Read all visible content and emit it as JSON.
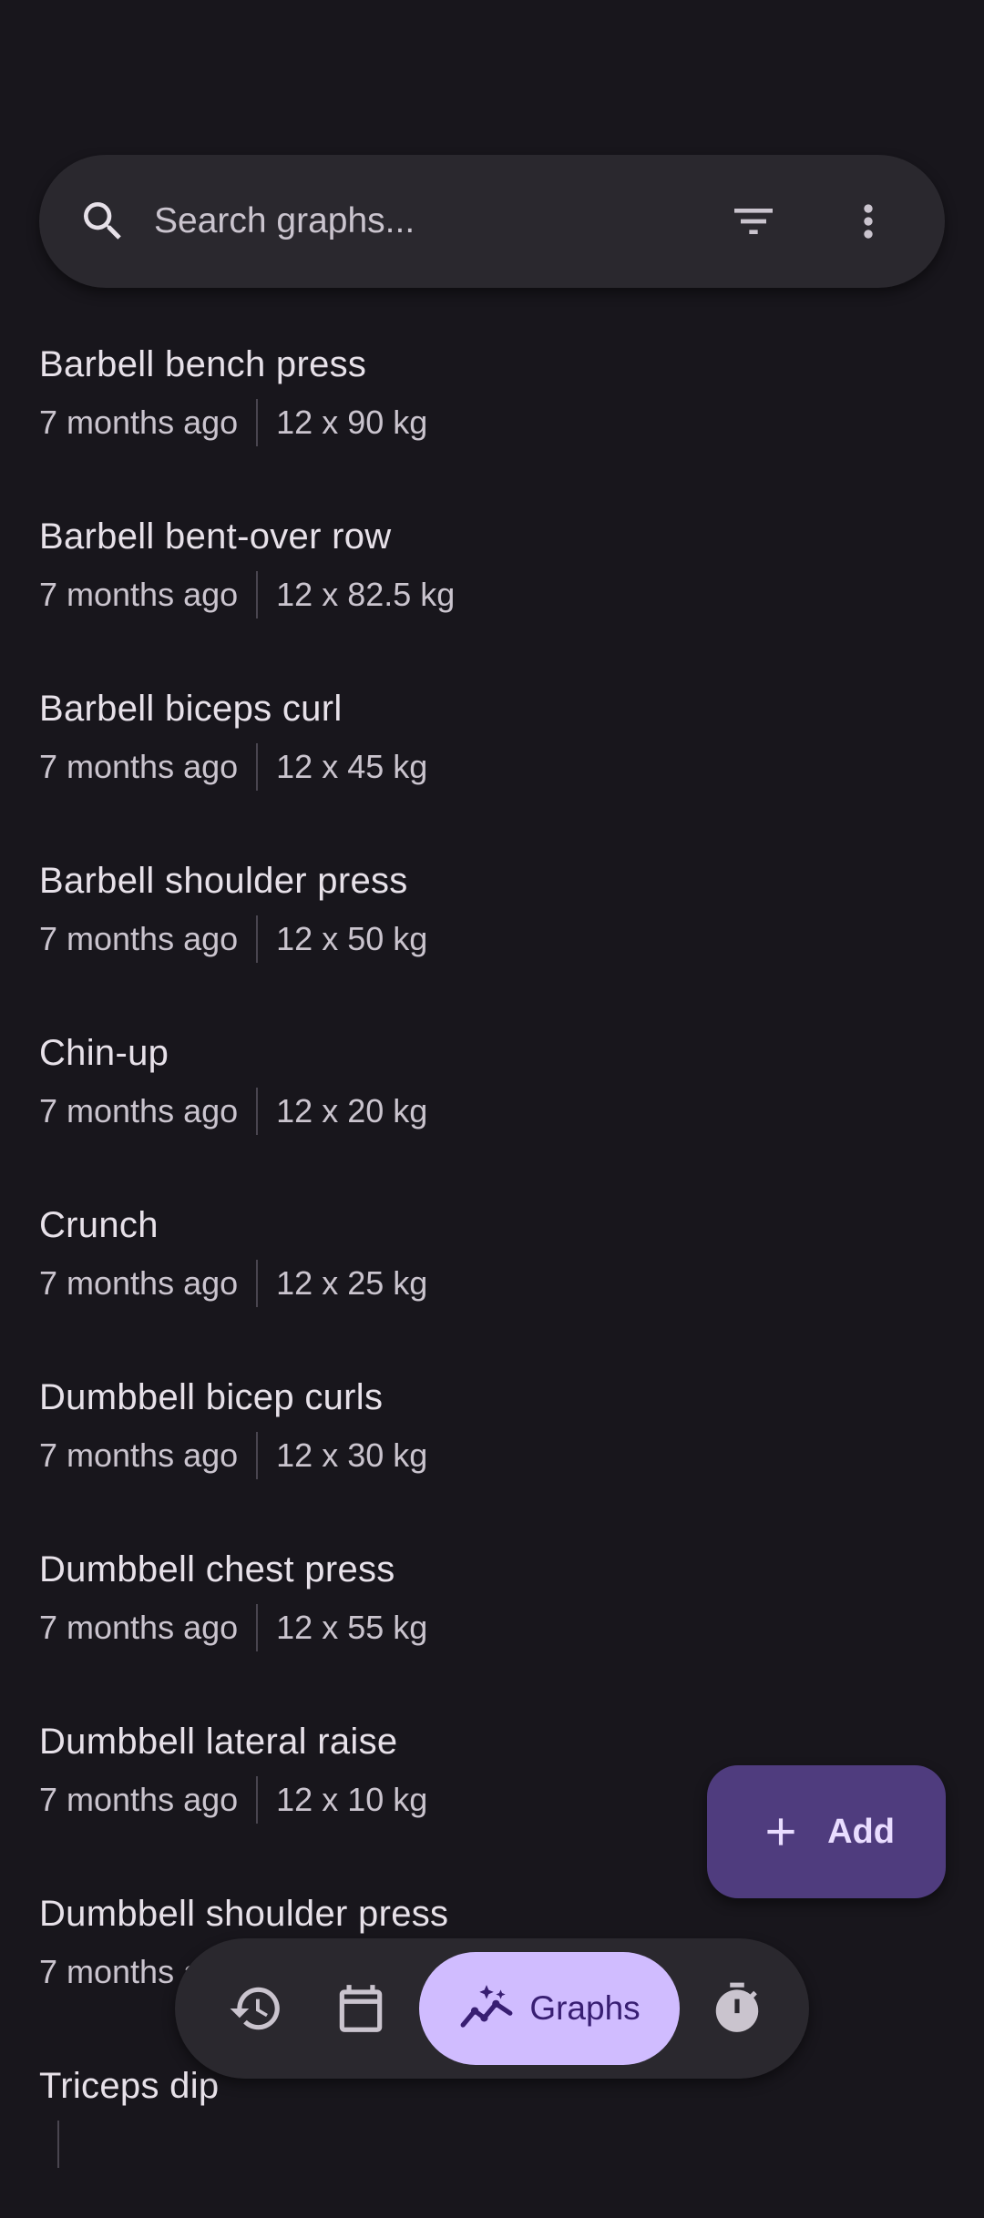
{
  "search": {
    "placeholder": "Search graphs...",
    "value": ""
  },
  "items": [
    {
      "title": "Barbell bench press",
      "time": "7 months ago",
      "stat": "12 x 90 kg"
    },
    {
      "title": "Barbell bent-over row",
      "time": "7 months ago",
      "stat": "12 x 82.5 kg"
    },
    {
      "title": "Barbell biceps curl",
      "time": "7 months ago",
      "stat": "12 x 45 kg"
    },
    {
      "title": "Barbell shoulder press",
      "time": "7 months ago",
      "stat": "12 x 50 kg"
    },
    {
      "title": "Chin-up",
      "time": "7 months ago",
      "stat": "12 x 20 kg"
    },
    {
      "title": "Crunch",
      "time": "7 months ago",
      "stat": "12 x 25 kg"
    },
    {
      "title": "Dumbbell bicep curls",
      "time": "7 months ago",
      "stat": "12 x 30 kg"
    },
    {
      "title": "Dumbbell chest press",
      "time": "7 months ago",
      "stat": "12 x 55 kg"
    },
    {
      "title": "Dumbbell lateral raise",
      "time": "7 months ago",
      "stat": "12 x 10 kg"
    },
    {
      "title": "Dumbbell shoulder press",
      "time": "7 months ago",
      "stat": ""
    },
    {
      "title": "Triceps dip",
      "time": "",
      "stat": ""
    }
  ],
  "fab": {
    "label": "Add",
    "icon": "plus-icon"
  },
  "nav": {
    "history_icon": "history-icon",
    "calendar_icon": "calendar-icon",
    "active_label": "Graphs",
    "active_icon": "graph-sparkle-icon",
    "timer_icon": "timer-icon"
  },
  "colors": {
    "background": "#18161c",
    "surface": "#2a282e",
    "fab": "#4f3c7e",
    "nav_active": "#d0bcff"
  }
}
